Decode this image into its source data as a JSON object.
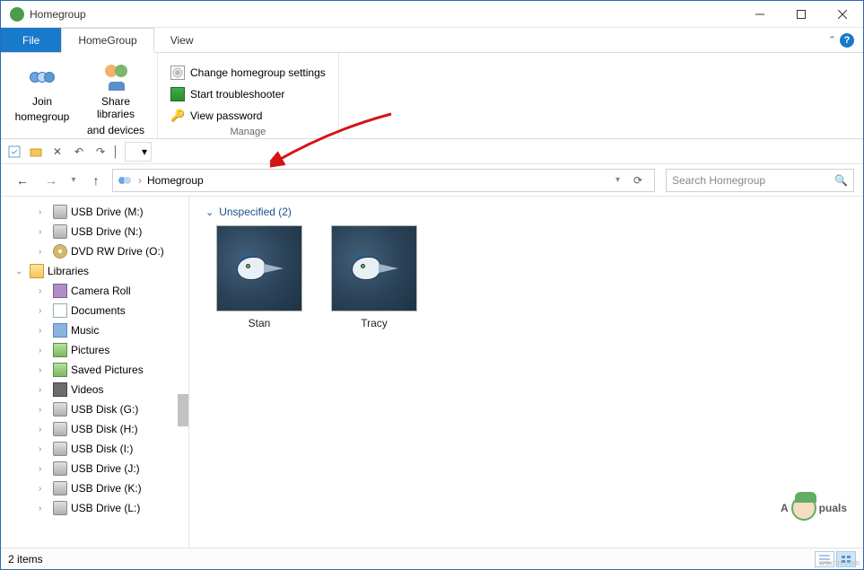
{
  "title": "Homegroup",
  "tabs": {
    "file": "File",
    "homegroup": "HomeGroup",
    "view": "View"
  },
  "ribbon": {
    "join": {
      "line1": "Join",
      "line2": "homegroup"
    },
    "share": {
      "line1": "Share libraries",
      "line2": "and devices"
    },
    "change": "Change homegroup settings",
    "trouble": "Start troubleshooter",
    "viewpw": "View password",
    "manage": "Manage"
  },
  "address": {
    "location": "Homegroup",
    "sep": "›"
  },
  "search": {
    "placeholder": "Search Homegroup"
  },
  "tree": {
    "usb_m": "USB Drive (M:)",
    "usb_n": "USB Drive (N:)",
    "dvd_o": "DVD RW Drive (O:)",
    "libraries": "Libraries",
    "camera": "Camera Roll",
    "documents": "Documents",
    "music": "Music",
    "pictures": "Pictures",
    "saved": "Saved Pictures",
    "videos": "Videos",
    "disk_g": "USB Disk (G:)",
    "disk_h": "USB Disk (H:)",
    "disk_i": "USB Disk (I:)",
    "drive_j": "USB Drive (J:)",
    "drive_k": "USB Drive (K:)",
    "drive_l": "USB Drive (L:)"
  },
  "content": {
    "group_label": "Unspecified (2)",
    "items": [
      {
        "name": "Stan"
      },
      {
        "name": "Tracy"
      }
    ]
  },
  "status": {
    "count": "2 items"
  },
  "watermark": {
    "pre": "A",
    "post": "puals"
  },
  "credit": "wsxdn.com"
}
